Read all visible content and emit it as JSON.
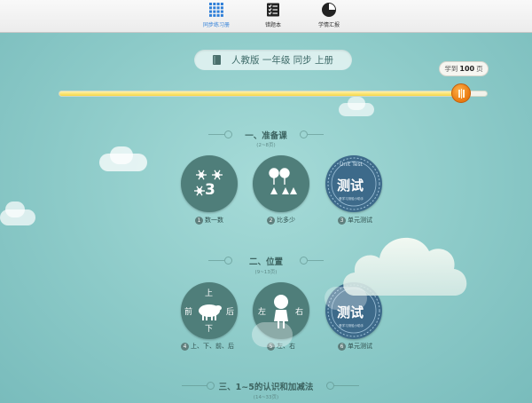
{
  "tabs": [
    {
      "label": "同步练习册",
      "icon": "grid-icon",
      "active": true
    },
    {
      "label": "错题本",
      "icon": "checklist-icon",
      "active": false
    },
    {
      "label": "学情汇报",
      "icon": "pie-chart-icon",
      "active": false
    }
  ],
  "book": {
    "label": "人教版 一年级 同步 上册"
  },
  "progress": {
    "prefix": "学到",
    "value": "100",
    "suffix": "页",
    "fraction": 0.94
  },
  "sections": [
    {
      "title": "一、准备课",
      "pages": "(2~8页)",
      "lessons": [
        {
          "num": "1",
          "label": "数一数",
          "icon_text": "3"
        },
        {
          "num": "2",
          "label": "比多少"
        },
        {
          "num": "3",
          "label": "单元测试",
          "icon_text": "测试",
          "ribbon": "Unit Test",
          "ring": "爱学习测验小助手"
        }
      ]
    },
    {
      "title": "二、位置",
      "pages": "(9~13页)",
      "lessons": [
        {
          "num": "4",
          "label": "上、下、前、后",
          "words": [
            "上",
            "下",
            "前",
            "后"
          ]
        },
        {
          "num": "5",
          "label": "左、右",
          "words": [
            "左",
            "右"
          ]
        },
        {
          "num": "6",
          "label": "单元测试",
          "icon_text": "测试",
          "ring": "爱学习测验小助手"
        }
      ]
    },
    {
      "title": "三、1~5的认识和加减法",
      "pages": "(14~33页)"
    }
  ],
  "colors": {
    "accent": "#2f7fd8",
    "knob": "#e8790e",
    "fill": "#f6d746",
    "badge": "#4f7e7a"
  }
}
